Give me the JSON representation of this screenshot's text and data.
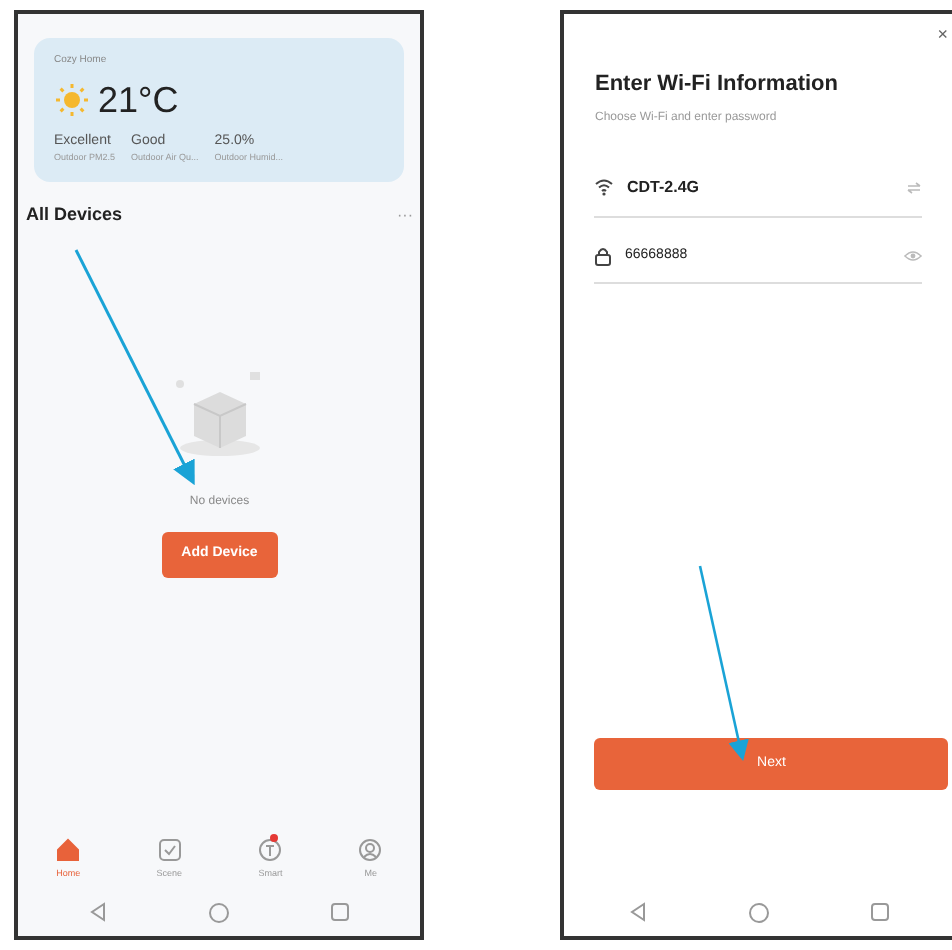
{
  "home_screen": {
    "home_name": "Cozy Home",
    "temperature": "21°C",
    "stats": [
      {
        "value": "Excellent",
        "label": "Outdoor PM2.5"
      },
      {
        "value": "Good",
        "label": "Outdoor Air Qu..."
      },
      {
        "value": "25.0%",
        "label": "Outdoor Humid..."
      }
    ],
    "section_title": "All Devices",
    "more": "···",
    "empty_text": "No devices",
    "add_button": "Add Device",
    "tabs": [
      {
        "label": "Home",
        "kind": "home",
        "selected": true,
        "badge": false
      },
      {
        "label": "Scene",
        "kind": "scene",
        "selected": false,
        "badge": false
      },
      {
        "label": "Smart",
        "kind": "smart",
        "selected": false,
        "badge": true
      },
      {
        "label": "Me",
        "kind": "me",
        "selected": false,
        "badge": false
      }
    ]
  },
  "wifi_screen": {
    "close": "×",
    "title": "Enter Wi-Fi Information",
    "subtitle": "Choose Wi-Fi and enter password",
    "network": "CDT-2.4G",
    "password": "66668888",
    "next_button": "Next"
  }
}
